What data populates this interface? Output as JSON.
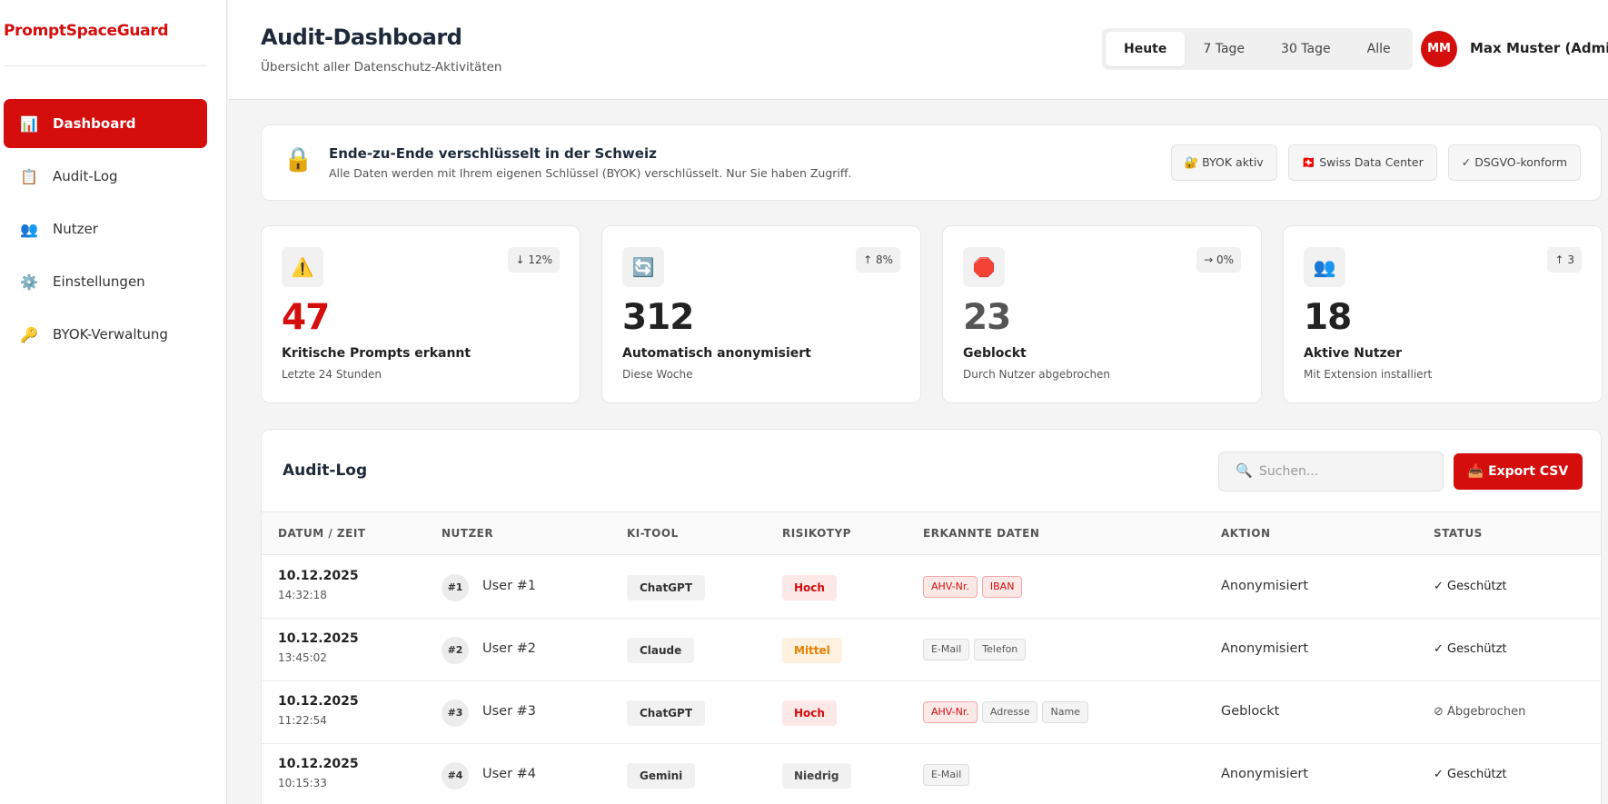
{
  "sidebar": {
    "brand": "PromptSpaceGuard",
    "items": [
      {
        "label": "Dashboard",
        "icon": "📊",
        "active": true
      },
      {
        "label": "Audit-Log",
        "icon": "📋"
      },
      {
        "label": "Nutzer",
        "icon": "👥"
      },
      {
        "label": "Einstellungen",
        "icon": "⚙️"
      },
      {
        "label": "BYOK-Verwaltung",
        "icon": "🔑"
      }
    ]
  },
  "header": {
    "title": "Audit-Dashboard",
    "subtitle": "Übersicht aller Datenschutz-Aktivitäten",
    "ranges": [
      "Heute",
      "7 Tage",
      "30 Tage",
      "Alle"
    ],
    "active_range": "Heute",
    "user": {
      "initials": "MM",
      "name": "Max Muster (Admin)"
    }
  },
  "banner": {
    "icon": "🔒",
    "title": "Ende-zu-Ende verschlüsselt in der Schweiz",
    "text": "Alle Daten werden mit Ihrem eigenen Schlüssel (BYOK) verschlüsselt. Nur Sie haben Zugriff.",
    "badges": [
      "🔐 BYOK aktiv",
      "🇨🇭 Swiss Data Center",
      "✓ DSGVO-konform"
    ]
  },
  "kpis": [
    {
      "icon": "⚠️",
      "trend": "↓ 12%",
      "value": "47",
      "label": "Kritische Prompts erkannt",
      "sub": "Letzte 24 Stunden"
    },
    {
      "icon": "🔄",
      "trend": "↑ 8%",
      "value": "312",
      "label": "Automatisch anonymisiert",
      "sub": "Diese Woche"
    },
    {
      "icon": "🛑",
      "trend": "→ 0%",
      "value": "23",
      "label": "Geblockt",
      "sub": "Durch Nutzer abgebrochen"
    },
    {
      "icon": "👥",
      "trend": "↑ 3",
      "value": "18",
      "label": "Aktive Nutzer",
      "sub": "Mit Extension installiert"
    }
  ],
  "audit_log": {
    "title": "Audit-Log",
    "search_placeholder": "Suchen...",
    "search_icon": "🔍",
    "export_label": "📥 Export CSV",
    "columns": [
      "DATUM / ZEIT",
      "NUTZER",
      "KI-TOOL",
      "RISIKOTYP",
      "ERKANNTE DATEN",
      "AKTION",
      "STATUS"
    ],
    "rows": [
      {
        "date": "10.12.2025",
        "time": "14:32:18",
        "user_num": "#1",
        "user": "User #1",
        "tool": "ChatGPT",
        "risk": "Hoch",
        "data": [
          "AHV-Nr.",
          "IBAN"
        ],
        "action": "Anonymisiert",
        "status": "✓ Geschützt"
      },
      {
        "date": "10.12.2025",
        "time": "13:45:02",
        "user_num": "#2",
        "user": "User #2",
        "tool": "Claude",
        "risk": "Mittel",
        "data": [
          "E-Mail",
          "Telefon"
        ],
        "action": "Anonymisiert",
        "status": "✓ Geschützt"
      },
      {
        "date": "10.12.2025",
        "time": "11:22:54",
        "user_num": "#3",
        "user": "User #3",
        "tool": "ChatGPT",
        "risk": "Hoch",
        "data": [
          "AHV-Nr.",
          "Adresse",
          "Name"
        ],
        "action": "Geblockt",
        "status": "⊘ Abgebrochen"
      },
      {
        "date": "10.12.2025",
        "time": "10:15:33",
        "user_num": "#4",
        "user": "User #4",
        "tool": "Gemini",
        "risk": "Niedrig",
        "data": [
          "E-Mail"
        ],
        "action": "Anonymisiert",
        "status": "✓ Geschützt"
      }
    ]
  },
  "colors": {
    "accent": "#d40d0d",
    "warning": "#e67e00",
    "background": "#f4f4f4"
  }
}
